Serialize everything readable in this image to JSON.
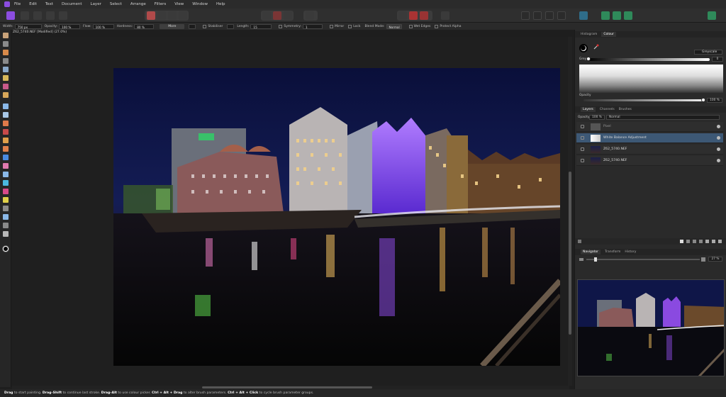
{
  "menu": [
    "File",
    "Edit",
    "Text",
    "Document",
    "Layer",
    "Select",
    "Arrange",
    "Filters",
    "View",
    "Window",
    "Help"
  ],
  "context": {
    "width_label": "Width:",
    "width_value": "750 px",
    "opacity_label": "Opacity:",
    "opacity_value": "100 %",
    "flow_label": "Flow:",
    "flow_value": "100 %",
    "hardness_label": "Hardness:",
    "hardness_value": "80 %",
    "more_label": "More",
    "stabiliser_label": "Stabiliser",
    "length_label": "Length:",
    "length_value": "15",
    "symmetry_label": "Symmetry:",
    "symmetry_value": "1",
    "mirror_label": "Mirror",
    "lock_label": "Lock",
    "blend_label": "Blend Mode:",
    "blend_value": "Normal",
    "wet_edges_label": "Wet Edges",
    "protect_alpha_label": "Protect Alpha"
  },
  "document": {
    "tab_title": "Z62_5740.NEF [Modified] (27.0%)"
  },
  "colour_panel": {
    "tabs": [
      "Histogram",
      "Colour"
    ],
    "active_tab": "Colour",
    "mode": "Greyscale",
    "grey_label": "Grey",
    "grey_value": "0",
    "opacity_label": "Opacity",
    "opacity_value": "100 %"
  },
  "layers_panel": {
    "tabs": [
      "Layers",
      "Channels",
      "Brushes"
    ],
    "active_tab": "Layers",
    "opacity_label": "Opacity:",
    "opacity_value": "100 %",
    "blend_mode": "Normal",
    "layers": [
      {
        "name": "Pixel",
        "selected": false
      },
      {
        "name": "White Balance Adjustment",
        "selected": true
      },
      {
        "name": "Z62_5740.NEF",
        "selected": false
      },
      {
        "name": "Z62_5740.NEF",
        "selected": false
      }
    ]
  },
  "navigator_panel": {
    "tabs": [
      "Navigator",
      "Transform",
      "History"
    ],
    "active_tab": "Navigator",
    "zoom_value": "27 %"
  },
  "status": {
    "k1": "Drag",
    "t1": " to start painting. ",
    "k2": "Drag–Shift",
    "t2": " to continue last stroke. ",
    "k3": "Drag–Alt",
    "t3": " to use colour picker. ",
    "k4": "Ctrl + Alt + Drag",
    "t4": " to alter brush parameters. ",
    "k5": "Ctrl + Alt + Click",
    "t5": " to cycle brush parameter groups."
  },
  "colors": {
    "accent": "#8c4de0",
    "selection": "#3d5875",
    "panel": "#2a2a2a"
  }
}
